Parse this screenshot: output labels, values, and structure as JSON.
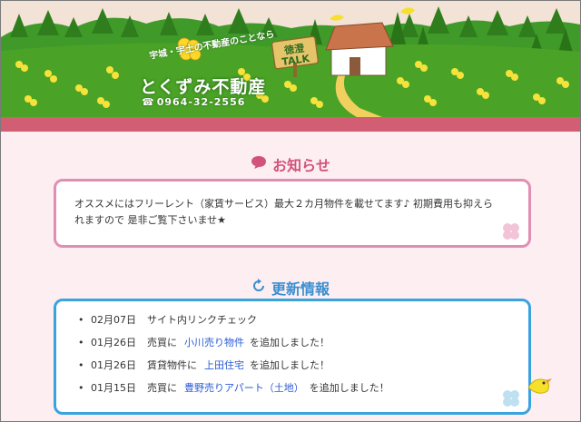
{
  "header": {
    "tagline": "宇城・宇土の不動産のことなら",
    "company": "とくずみ不動産",
    "phone": "0964-32-2556",
    "sign": "徳澄 TALK",
    "colors": {
      "sky": "#f3e2d6",
      "grass": "#4aa326",
      "stripe": "#d25e74"
    }
  },
  "notice": {
    "title": "お知らせ",
    "icon": "speech-bubble-icon",
    "text": "オススメにはフリーレント（家賃サービス）最大２カ月物件を載せてます♪ 初期費用も抑えられますので 是非ご覧下さいませ★"
  },
  "updates": {
    "title": "更新情報",
    "icon": "refresh-icon",
    "items": [
      {
        "date": "02月07日",
        "text": "サイト内リンクチェック",
        "category": "",
        "link": "",
        "suffix": ""
      },
      {
        "date": "01月26日",
        "category": "売買に",
        "link": "小川売り物件",
        "suffix": "を追加しました！",
        "text": ""
      },
      {
        "date": "01月26日",
        "category": "賃貸物件に",
        "link": "上田住宅",
        "suffix": "を追加しました！",
        "text": ""
      },
      {
        "date": "01月15日",
        "category": "売買に",
        "link": "豊野売りアパート（土地）",
        "suffix": "を追加しました！",
        "text": ""
      }
    ]
  }
}
